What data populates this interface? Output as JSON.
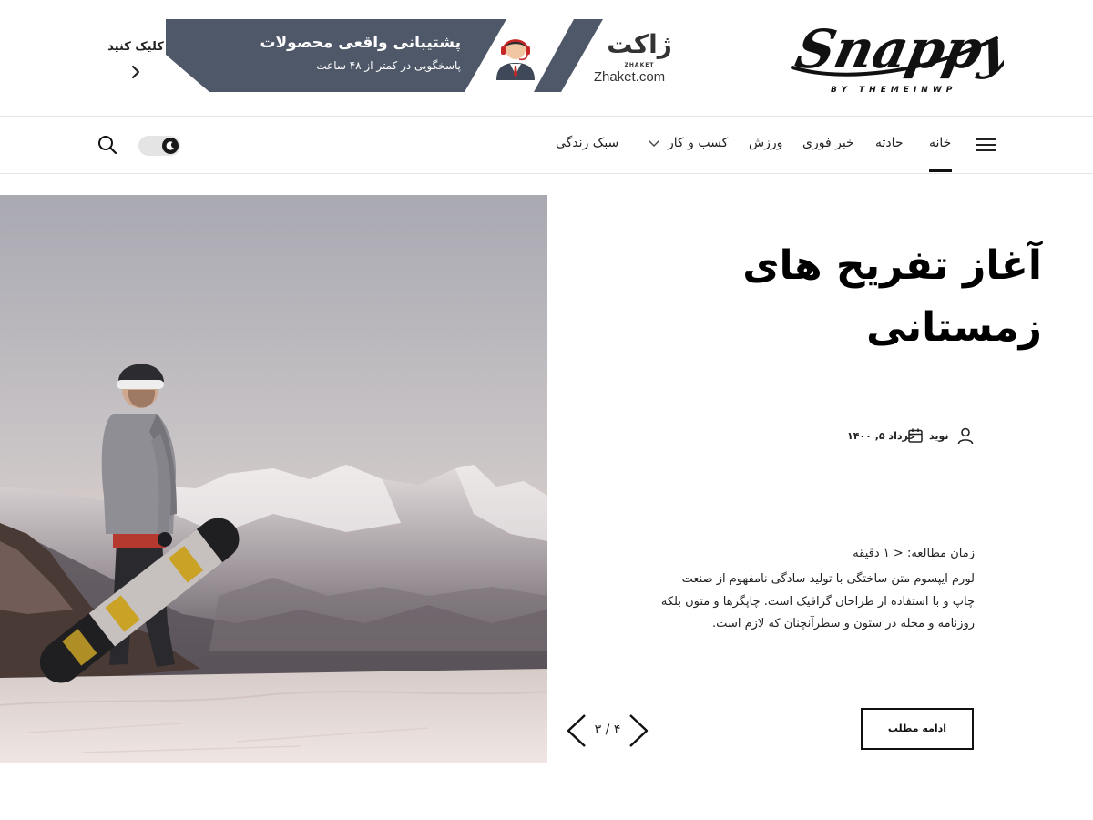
{
  "site": {
    "logo_text": "Snappy",
    "logo_tagline": "BY THEMEINWP"
  },
  "ad_banner": {
    "title": "پشتیبانی واقعی محصولات",
    "subtitle": "پاسخگویی در کمتر از ۴۸ ساعت",
    "click_label": "کلیک کنید",
    "brand_mark": "ژاکت",
    "brand_sub": "ZHAKET",
    "brand_domain": "Zhaket.com",
    "banner_color": "#4f5869"
  },
  "nav": {
    "items": [
      {
        "label": "خانه",
        "active": true
      },
      {
        "label": "حادثه"
      },
      {
        "label": "خبر فوری"
      },
      {
        "label": "ورزش"
      },
      {
        "label": "کسب و کار",
        "has_dropdown": true
      },
      {
        "label": "سبک زندگی"
      }
    ],
    "icons": [
      "menu-icon",
      "theme-toggle",
      "moon-icon",
      "search-icon"
    ]
  },
  "hero": {
    "image": "snowboarder-mountain-sunset",
    "title": "آغاز تفریح های زمستانی",
    "author": "نوید",
    "date": "خرداد ۵, ۱۴۰۰",
    "read_time": "زمان مطالعه: < ۱ دقیقه",
    "excerpt": "لورم ایپسوم متن ساختگی با تولید سادگی نامفهوم از صنعت چاپ و با استفاده از طراحان گرافیک است. چاپگرها و متون بلکه روزنامه و مجله در ستون و سطرآنچنان که لازم است.",
    "read_more": "ادامه مطلب",
    "slider_position": "۴ / ۳"
  }
}
